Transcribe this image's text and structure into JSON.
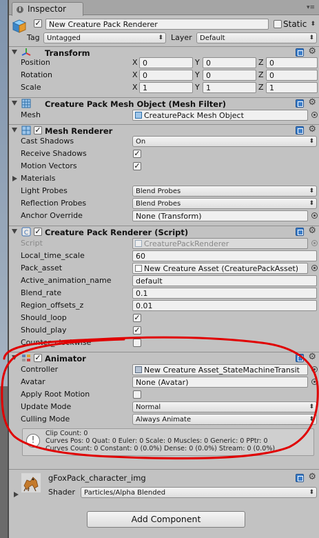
{
  "window": {
    "tab_label": "Inspector"
  },
  "header": {
    "object_name": "New Creature Pack Renderer",
    "static_label": "Static",
    "tag_label": "Tag",
    "tag_value": "Untagged",
    "layer_label": "Layer",
    "layer_value": "Default"
  },
  "transform": {
    "title": "Transform",
    "rows": [
      {
        "label": "Position",
        "x": "0",
        "y": "0",
        "z": "0"
      },
      {
        "label": "Rotation",
        "x": "0",
        "y": "0",
        "z": "0"
      },
      {
        "label": "Scale",
        "x": "1",
        "y": "1",
        "z": "1"
      }
    ],
    "axis_x": "X",
    "axis_y": "Y",
    "axis_z": "Z"
  },
  "mesh_filter": {
    "title": "Creature Pack Mesh Object (Mesh Filter)",
    "mesh_label": "Mesh",
    "mesh_value": "CreaturePack Mesh Object"
  },
  "mesh_renderer": {
    "title": "Mesh Renderer",
    "cast_shadows_label": "Cast Shadows",
    "cast_shadows_value": "On",
    "receive_shadows_label": "Receive Shadows",
    "receive_shadows_checked": true,
    "motion_vectors_label": "Motion Vectors",
    "motion_vectors_checked": true,
    "materials_label": "Materials",
    "light_probes_label": "Light Probes",
    "light_probes_value": "Blend Probes",
    "reflection_probes_label": "Reflection Probes",
    "reflection_probes_value": "Blend Probes",
    "anchor_override_label": "Anchor Override",
    "anchor_override_value": "None (Transform)"
  },
  "script_component": {
    "title": "Creature Pack Renderer (Script)",
    "script_label": "Script",
    "script_value": "CreaturePackRenderer",
    "local_time_scale_label": "Local_time_scale",
    "local_time_scale_value": "60",
    "pack_asset_label": "Pack_asset",
    "pack_asset_value": "New Creature Asset (CreaturePackAsset)",
    "active_animation_label": "Active_animation_name",
    "active_animation_value": "default",
    "blend_rate_label": "Blend_rate",
    "blend_rate_value": "0.1",
    "region_offsets_label": "Region_offsets_z",
    "region_offsets_value": "0.01",
    "should_loop_label": "Should_loop",
    "should_loop_checked": true,
    "should_play_label": "Should_play",
    "should_play_checked": true,
    "counter_clockwise_label": "Counter_clockwise",
    "counter_clockwise_checked": false
  },
  "animator": {
    "title": "Animator",
    "controller_label": "Controller",
    "controller_value": "New Creature Asset_StateMachineTransit",
    "avatar_label": "Avatar",
    "avatar_value": "None (Avatar)",
    "apply_root_motion_label": "Apply Root Motion",
    "apply_root_motion_checked": false,
    "update_mode_label": "Update Mode",
    "update_mode_value": "Normal",
    "culling_mode_label": "Culling Mode",
    "culling_mode_value": "Always Animate",
    "info_lines": [
      "Clip Count: 0",
      "Curves Pos: 0 Quat: 0 Euler: 0 Scale: 0 Muscles: 0 Generic: 0 PPtr: 0",
      "Curves Count: 0 Constant: 0 (0.0%) Dense: 0 (0.0%) Stream: 0 (0.0%)"
    ]
  },
  "material": {
    "name": "gFoxPack_character_img",
    "shader_label": "Shader",
    "shader_value": "Particles/Alpha Blended"
  },
  "add_component_label": "Add Component",
  "colors": {
    "annotation_red": "#e00000",
    "panel_bg": "#c2c2c2",
    "help_blue": "#3d7ec8"
  }
}
